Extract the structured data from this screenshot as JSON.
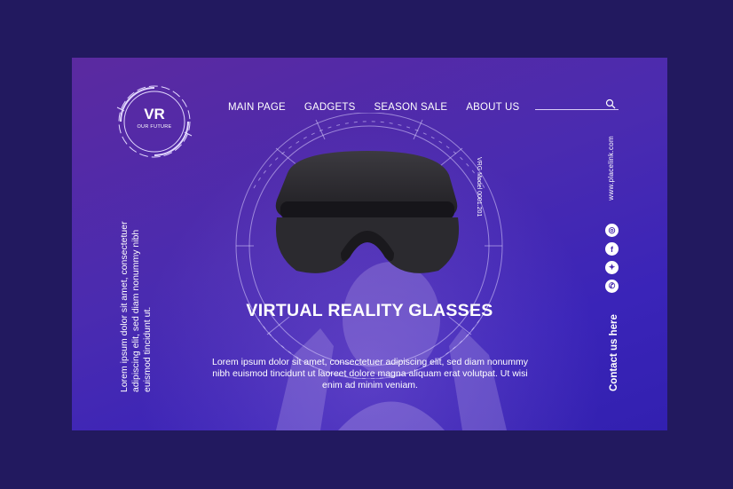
{
  "logo": {
    "title": "VR",
    "subtitle": "OUR FUTURE"
  },
  "nav": {
    "items": [
      "MAIN PAGE",
      "GADGETS",
      "SEASON SALE",
      "ABOUT US"
    ]
  },
  "hud": {
    "model_label": "VRG Model 0001.201"
  },
  "hero": {
    "title": "VIRTUAL REALITY GLASSES",
    "text": "Lorem ipsum dolor sit amet, consectetuer adipiscing elit, sed diam nonummy nibh euismod tincidunt ut laoreet dolore magna aliquam erat volutpat. Ut wisi enim ad minim veniam."
  },
  "side": {
    "left_text": "Lorem ipsum dolor sit amet, consectetuer adipiscing elit, sed diam nonummy nibh euismod tincidunt ut.",
    "url": "www.placelink.com",
    "contact": "Contact us here"
  },
  "socials": [
    {
      "icon": "instagram-icon",
      "glyph": "◎"
    },
    {
      "icon": "facebook-icon",
      "glyph": "f"
    },
    {
      "icon": "twitter-icon",
      "glyph": "✦"
    },
    {
      "icon": "whatsapp-icon",
      "glyph": "✆"
    }
  ],
  "colors": {
    "background": "#22195f",
    "card_top": "#5b2aa0",
    "card_bottom": "#3220b0"
  }
}
